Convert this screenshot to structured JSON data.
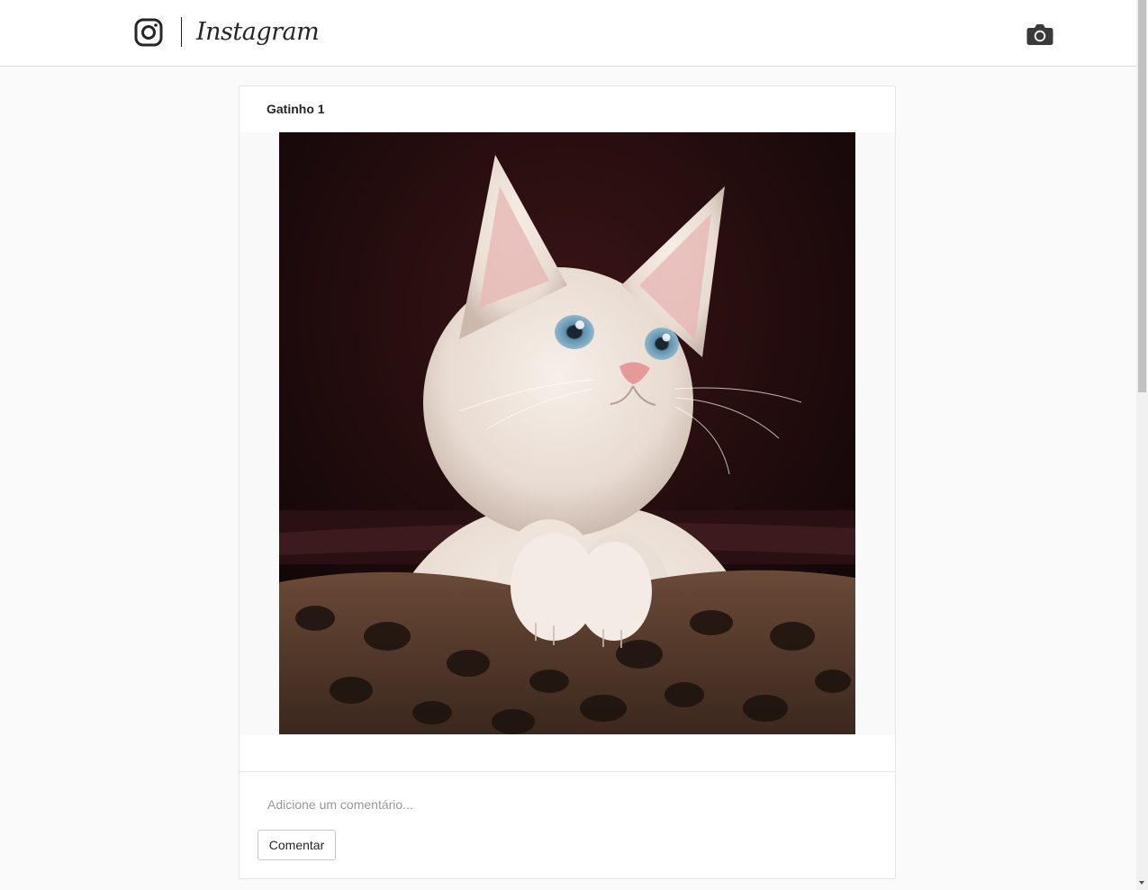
{
  "header": {
    "brand": "Instagram",
    "logo_icon": "instagram-glyph-icon",
    "camera_icon": "camera-icon"
  },
  "post": {
    "title": "Gatinho 1",
    "image_alt": "kitten"
  },
  "comment": {
    "placeholder": "Adicione um comentário...",
    "submit_label": "Comentar"
  },
  "colors": {
    "background": "#fafafa",
    "card": "#ffffff",
    "border": "#dbdbdb",
    "text": "#262626",
    "placeholder": "#999999"
  }
}
